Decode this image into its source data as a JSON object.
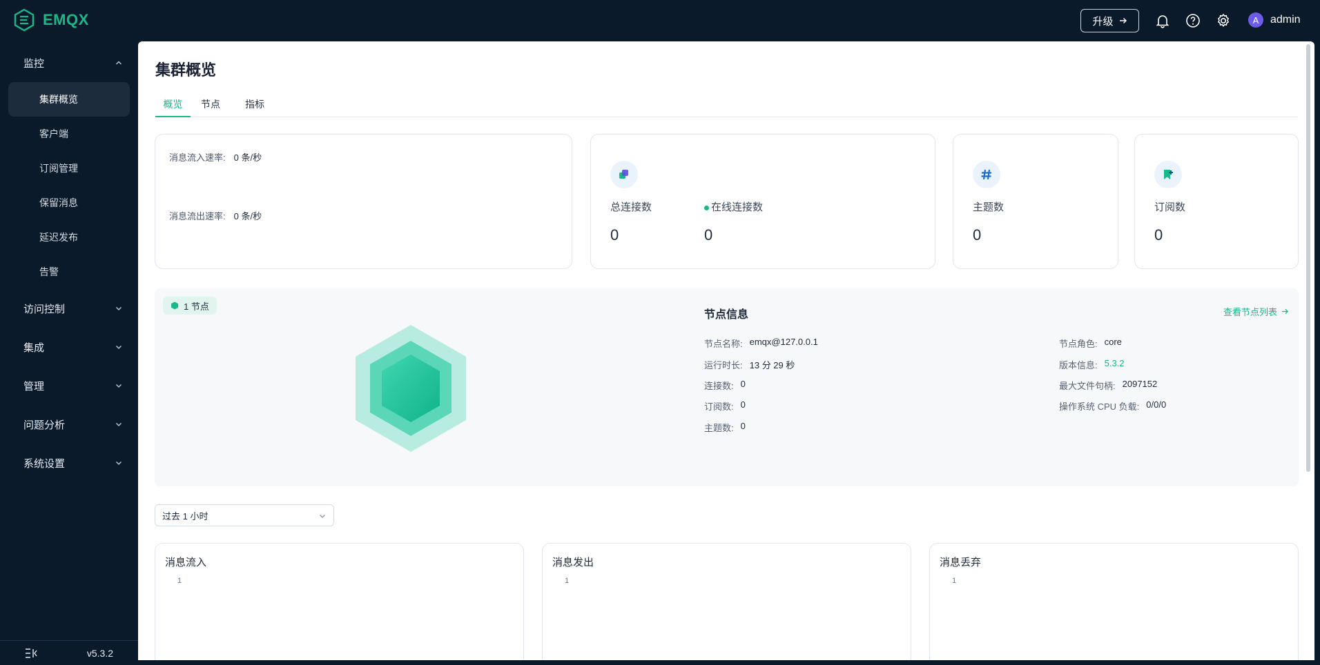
{
  "app": {
    "logo_text": "EMQX",
    "upgrade_label": "升级",
    "user_initial": "A",
    "username": "admin"
  },
  "sidebar": {
    "groups": [
      {
        "label": "监控"
      },
      {
        "label": "访问控制"
      },
      {
        "label": "集成"
      },
      {
        "label": "管理"
      },
      {
        "label": "问题分析"
      },
      {
        "label": "系统设置"
      }
    ],
    "monitor_items": [
      {
        "label": "集群概览",
        "active": true
      },
      {
        "label": "客户端"
      },
      {
        "label": "订阅管理"
      },
      {
        "label": "保留消息"
      },
      {
        "label": "延迟发布"
      },
      {
        "label": "告警"
      }
    ],
    "version": "v5.3.2"
  },
  "page": {
    "title": "集群概览",
    "tabs": [
      {
        "label": "概览",
        "active": true
      },
      {
        "label": "节点"
      },
      {
        "label": "指标"
      }
    ]
  },
  "rates": {
    "in_label": "消息流入速率:",
    "in_value": "0 条/秒",
    "out_label": "消息流出速率:",
    "out_value": "0 条/秒"
  },
  "stats": {
    "total_conn_label": "总连接数",
    "total_conn_value": "0",
    "online_conn_label": "在线连接数",
    "online_conn_value": "0",
    "topics_label": "主题数",
    "topics_value": "0",
    "subs_label": "订阅数",
    "subs_value": "0"
  },
  "node": {
    "badge": "1 节点",
    "info_title": "节点信息",
    "view_list_link": "查看节点列表",
    "left": [
      {
        "k": "节点名称:",
        "v": "emqx@127.0.0.1"
      },
      {
        "k": "运行时长:",
        "v": "13 分 29 秒"
      },
      {
        "k": "连接数:",
        "v": "0"
      },
      {
        "k": "订阅数:",
        "v": "0"
      },
      {
        "k": "主题数:",
        "v": "0"
      }
    ],
    "right": [
      {
        "k": "节点角色:",
        "v": "core"
      },
      {
        "k": "版本信息:",
        "v": "5.3.2"
      },
      {
        "k": "最大文件句柄:",
        "v": "2097152"
      },
      {
        "k": "操作系统 CPU 负载:",
        "v": "0/0/0"
      }
    ]
  },
  "time_range": {
    "selected": "过去 1 小时"
  },
  "charts": [
    {
      "title": "消息流入",
      "tick": "1"
    },
    {
      "title": "消息发出",
      "tick": "1"
    },
    {
      "title": "消息丢弃",
      "tick": "1"
    }
  ],
  "colors": {
    "accent": "#18b889",
    "sidebar_bg": "#0b1a2b",
    "node_panel_bg": "#f6f8fa"
  }
}
